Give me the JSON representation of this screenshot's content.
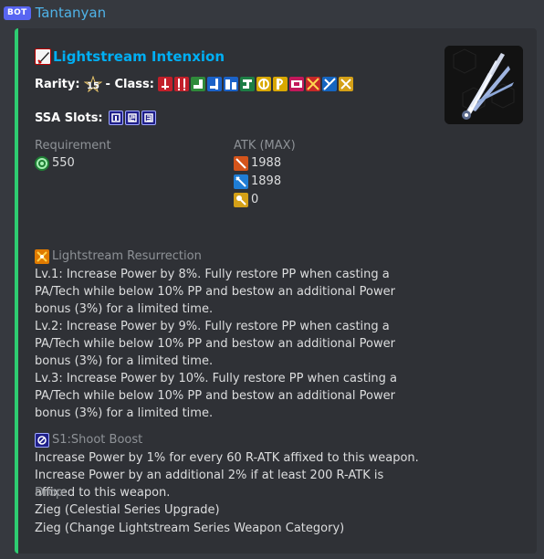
{
  "message": {
    "bot_tag": "BOT",
    "username": "Tantanyan"
  },
  "embed": {
    "accent_color": "#2ecc71",
    "title": "Lightstream Intenxion",
    "title_icon": "sword-icon",
    "rarity_label": "Rarity:",
    "rarity_icon": "rarity-15-star-icon",
    "class_label": "- Class:",
    "class_icons": [
      "hunter-icon",
      "fighter-icon",
      "ranger-icon",
      "gunner-icon",
      "force-icon",
      "techter-icon",
      "braver-icon",
      "bouncer-icon",
      "summoner-icon",
      "hero-icon",
      "phantom-icon",
      "etoile-icon",
      "luster-icon"
    ],
    "ssa_label": "SSA Slots:",
    "ssa_icons": [
      "ssa-slot-s1-icon",
      "ssa-slot-s2-icon",
      "ssa-slot-s3-icon"
    ],
    "requirement": {
      "name": "Requirement",
      "icon": "ranged-stat-icon",
      "value": "550"
    },
    "atk": {
      "name": "ATK (MAX)",
      "values": [
        {
          "icon": "melee-atk-icon",
          "value": "1988"
        },
        {
          "icon": "ranged-atk-icon",
          "value": "1898"
        },
        {
          "icon": "tech-atk-icon",
          "value": "0"
        }
      ]
    },
    "potential": {
      "icon": "potential-icon",
      "name": "Lightstream Resurrection",
      "lines": [
        "Lv.1: Increase Power by 8%. Fully restore PP when casting a PA/Tech while below 10% PP and bestow an additional Power bonus (3%) for a limited time.",
        "Lv.2: Increase Power by 9%. Fully restore PP when casting a PA/Tech while below 10% PP and bestow an additional Power bonus (3%) for a limited time.",
        "Lv.3: Increase Power by 10%. Fully restore PP when casting a PA/Tech while below 10% PP and bestow an additional Power bonus (3%) for a limited time."
      ]
    },
    "s1": {
      "icon": "s1-slot-icon",
      "name": "S1:Shoot Boost",
      "text": "Increase Power by 1% for every 60 R-ATK affixed to this weapon. Increase Power by an additional 2% if at least 200 R-ATK is affixed to this weapon."
    },
    "drop": {
      "name": "Drop:",
      "lines": [
        "Zieg (Celestial Series Upgrade)",
        "Zieg (Change Lightstream Series Weapon Category)"
      ]
    },
    "thumbnail": "weapon-thumbnail"
  }
}
